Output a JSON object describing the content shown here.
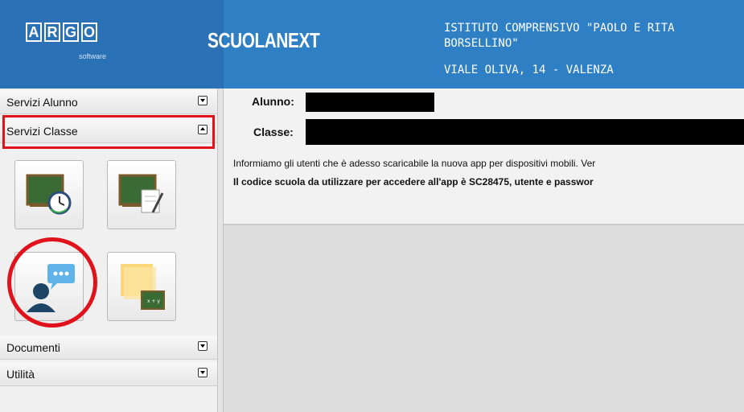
{
  "header": {
    "logo_letters": [
      "A",
      "R",
      "G",
      "O"
    ],
    "logo_subtitle": "software",
    "brand": "SCUOLANEXT",
    "school_name": "ISTITUTO COMPRENSIVO \"PAOLO E RITA BORSELLINO\"",
    "school_address": "VIALE OLIVA, 14 - VALENZA",
    "background_color": "#2f7fc4"
  },
  "sidebar": {
    "sections": [
      {
        "label": "Servizi Alunno",
        "state": "collapsed"
      },
      {
        "label": "Servizi Classe",
        "state": "expanded"
      },
      {
        "label": "Documenti",
        "state": "collapsed"
      },
      {
        "label": "Utilità",
        "state": "collapsed"
      }
    ],
    "tiles": [
      {
        "icon": "blackboard-clock-icon"
      },
      {
        "icon": "blackboard-pencil-icon"
      },
      {
        "icon": "user-chat-icon"
      },
      {
        "icon": "sticky-note-blackboard-icon"
      }
    ],
    "highlight_color": "#e0131c"
  },
  "main": {
    "student_label": "Alunno:",
    "class_label": "Classe:",
    "info_text": "Informiamo gli utenti che è adesso scaricabile la nuova app per dispositivi mobili. Ver",
    "info_bold_text": "Il codice scuola da utilizzare per accedere all'app è SC28475, utente e passwor"
  }
}
